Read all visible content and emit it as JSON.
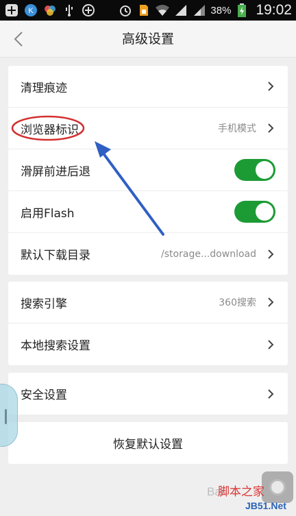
{
  "status_bar": {
    "battery_percent": "38%",
    "time": "19:02",
    "icons": [
      "plus-icon",
      "k-app-icon",
      "color-app-icon",
      "usb-icon",
      "add-circle-icon",
      "alarm-icon",
      "sim-icon",
      "wifi-icon",
      "signal-icon",
      "signal-icon-2",
      "battery-icon"
    ]
  },
  "header": {
    "title": "高级设置",
    "back_icon": "back-arrow-icon"
  },
  "sections": {
    "general": {
      "clear_traces": "清理痕迹",
      "browser_id": "浏览器标识",
      "browser_id_value": "手机模式",
      "swipe_nav": "滑屏前进后退",
      "swipe_nav_on": true,
      "flash": "启用Flash",
      "flash_on": true,
      "download_dir": "默认下载目录",
      "download_dir_value": "/storage...download"
    },
    "search": {
      "engine": "搜索引擎",
      "engine_value": "360搜索",
      "local_search": "本地搜索设置"
    },
    "security": {
      "label": "安全设置"
    },
    "reset": {
      "label": "恢复默认设置"
    }
  },
  "watermark": {
    "site_text": "脚本之家",
    "site_url": "JB51.Net",
    "baidu": "Bai"
  },
  "colors": {
    "toggle_on": "#1c9b34",
    "annotation_red": "#d32f2f",
    "annotation_blue": "#2f5fc4",
    "background": "#efefef"
  }
}
